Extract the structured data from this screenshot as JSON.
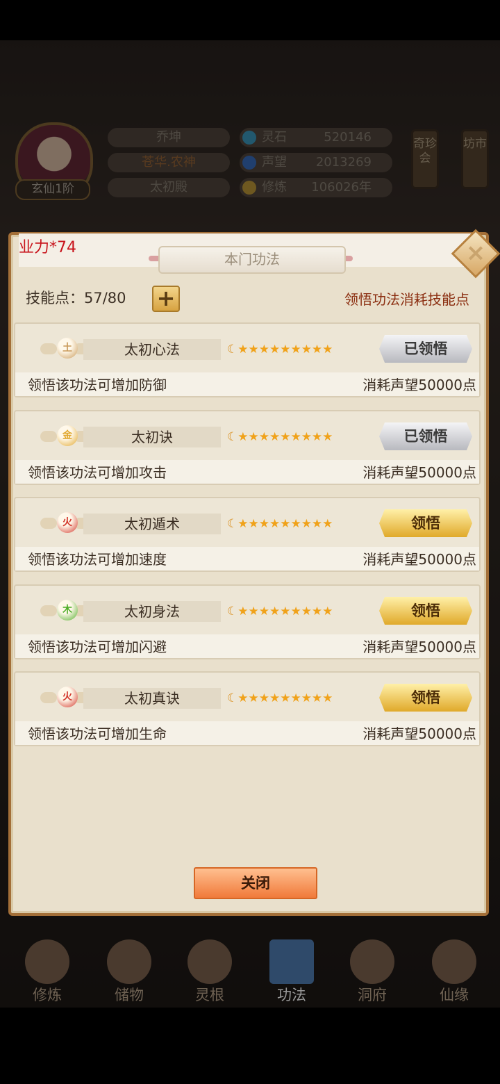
{
  "player": {
    "rank": "玄仙1阶",
    "name": "乔坤",
    "title": "苍华.农神",
    "sect": "太初殿"
  },
  "resources": [
    {
      "label": "灵石",
      "value": "520146",
      "color": "#3ea1c9"
    },
    {
      "label": "声望",
      "value": "2013269",
      "color": "#3b74c9"
    },
    {
      "label": "修炼",
      "value": "106026年",
      "color": "#c9a13b"
    }
  ],
  "side_buttons": {
    "treasure": "奇珍会",
    "market": "坊市"
  },
  "dialog": {
    "notification": "业力*74",
    "title": "本门功法",
    "skill_points_label": "技能点：",
    "skill_points_value": "57/80",
    "plus_label": "+",
    "hint": "领悟功法消耗技能点",
    "close_label": "关闭",
    "close_icon": "×"
  },
  "skills": [
    {
      "element": "土",
      "element_color": "#c99a5a",
      "name": "太初心法",
      "action": "已领悟",
      "learned": true,
      "desc": "领悟该功法可增加防御",
      "cost": "消耗声望50000点",
      "stars": 9
    },
    {
      "element": "金",
      "element_color": "#e0a62a",
      "name": "太初诀",
      "action": "已领悟",
      "learned": true,
      "desc": "领悟该功法可增加攻击",
      "cost": "消耗声望50000点",
      "stars": 9
    },
    {
      "element": "火",
      "element_color": "#d2352a",
      "name": "太初遁术",
      "action": "领悟",
      "learned": false,
      "desc": "领悟该功法可增加速度",
      "cost": "消耗声望50000点",
      "stars": 9
    },
    {
      "element": "木",
      "element_color": "#4fae2a",
      "name": "太初身法",
      "action": "领悟",
      "learned": false,
      "desc": "领悟该功法可增加闪避",
      "cost": "消耗声望50000点",
      "stars": 9
    },
    {
      "element": "火",
      "element_color": "#d2352a",
      "name": "太初真诀",
      "action": "领悟",
      "learned": false,
      "desc": "领悟该功法可增加生命",
      "cost": "消耗声望50000点",
      "stars": 9
    }
  ],
  "nav": [
    {
      "label": "修炼"
    },
    {
      "label": "储物"
    },
    {
      "label": "灵根"
    },
    {
      "label": "功法"
    },
    {
      "label": "洞府"
    },
    {
      "label": "仙缘"
    }
  ]
}
